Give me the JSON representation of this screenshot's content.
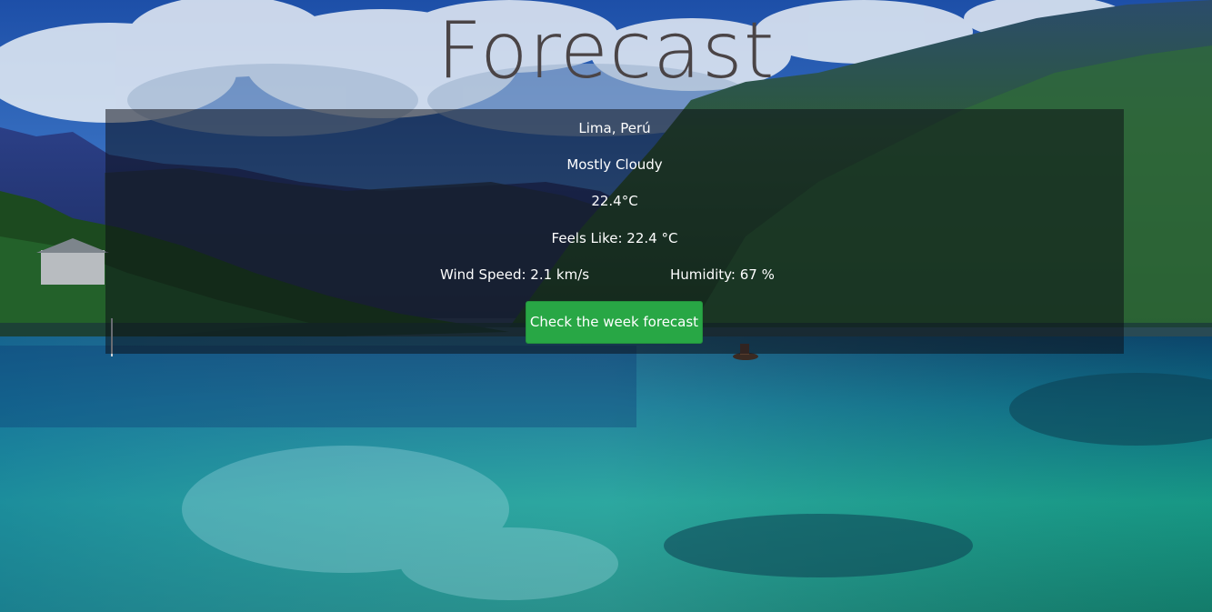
{
  "header": {
    "title": "Forecast"
  },
  "weather": {
    "location": "Lima, Perú",
    "condition": "Mostly Cloudy",
    "temperature": "22.4°C",
    "feels_like": "Feels Like: 22.4 °C",
    "wind_speed": "Wind Speed: 2.1 km/s",
    "humidity": "Humidity: 67 %"
  },
  "actions": {
    "week_forecast_label": "Check the week forecast"
  },
  "colors": {
    "button": "#28a745",
    "title": "#4a4446",
    "panel_overlay": "#0c0e16"
  }
}
